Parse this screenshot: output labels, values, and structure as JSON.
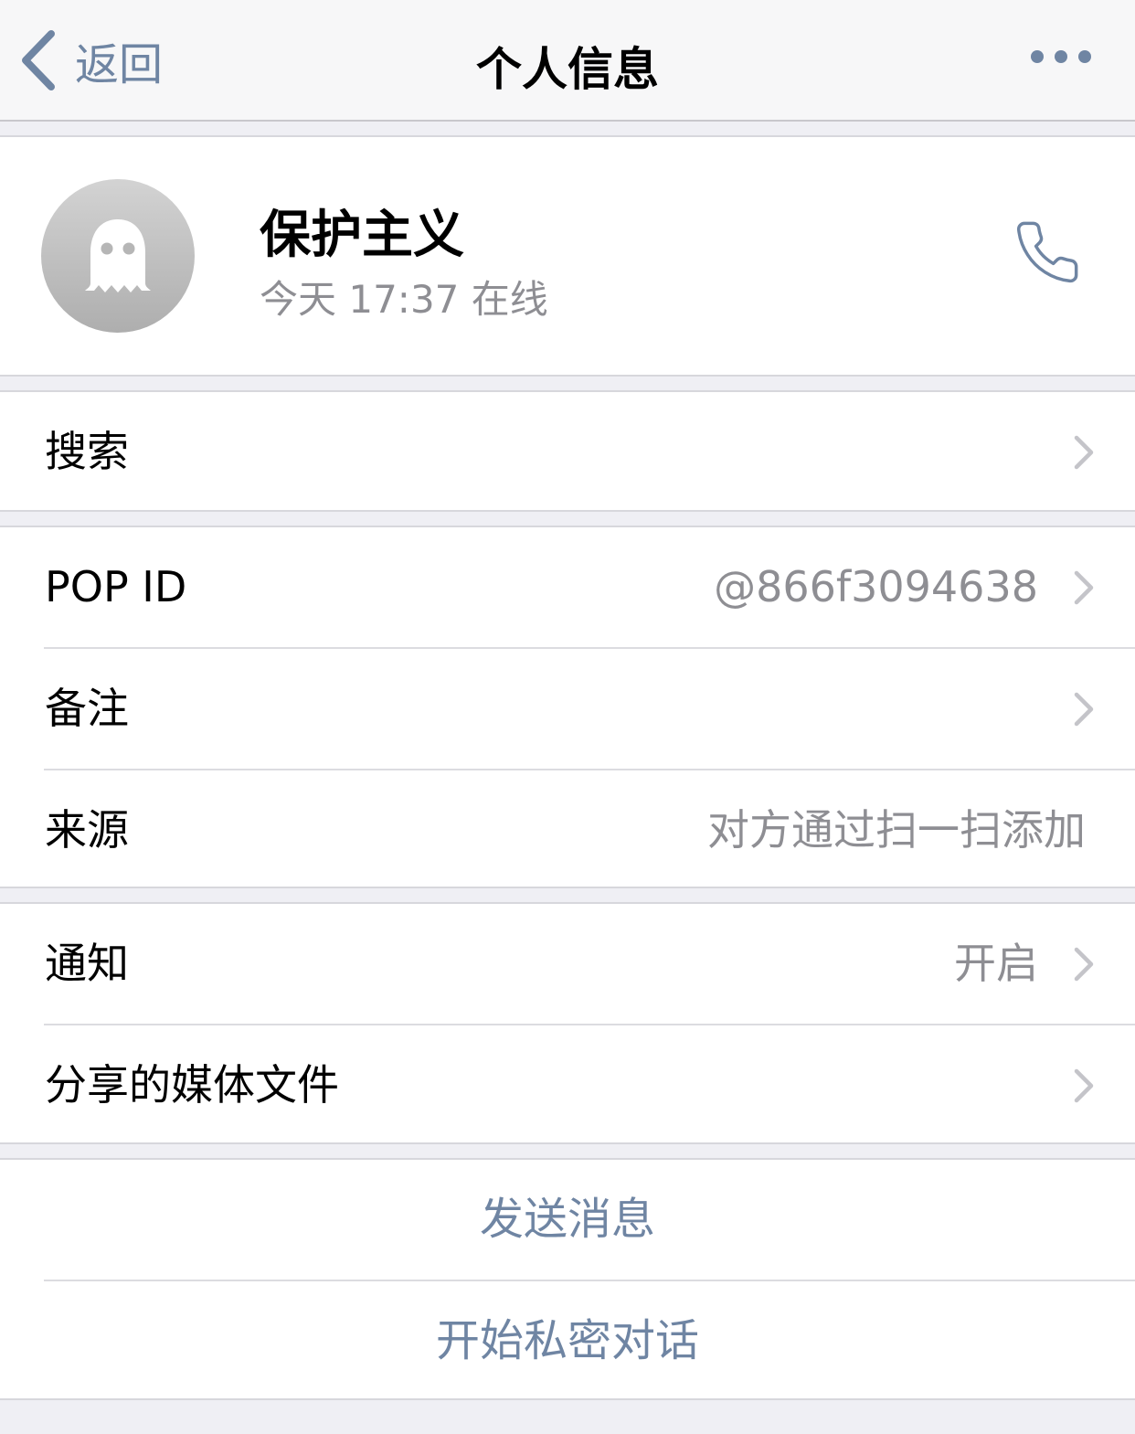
{
  "nav": {
    "back_label": "返回",
    "title": "个人信息",
    "more_icon": "ellipsis-icon"
  },
  "profile": {
    "name": "保护主义",
    "status": "今天 17:37 在线",
    "avatar_icon": "ghost-icon",
    "call_icon": "phone-icon"
  },
  "search": {
    "label": "搜索"
  },
  "info": {
    "pop_id_label": "POP ID",
    "pop_id_value": "@866f3094638",
    "note_label": "备注",
    "source_label": "来源",
    "source_value": "对方通过扫一扫添加"
  },
  "notify": {
    "notification_label": "通知",
    "notification_value": "开启",
    "shared_media_label": "分享的媒体文件"
  },
  "actions": {
    "send_message": "发送消息",
    "secret_chat": "开始私密对话"
  },
  "colors": {
    "accent": "#6f85a3",
    "secondary_text": "#8e8e93",
    "background": "#efeff4"
  }
}
